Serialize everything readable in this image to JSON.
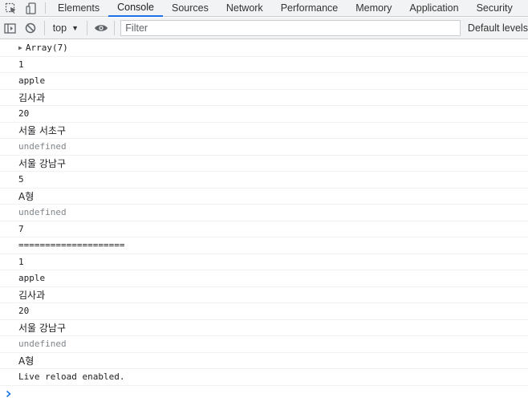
{
  "tabs": [
    "Elements",
    "Console",
    "Sources",
    "Network",
    "Performance",
    "Memory",
    "Application",
    "Security"
  ],
  "active_tab": "Console",
  "toolbar": {
    "context": "top",
    "filter_placeholder": "Filter",
    "levels_label": "Default levels"
  },
  "console": {
    "array_label": "Array(7)",
    "lines": [
      "1",
      "apple",
      "김사과",
      "20",
      "서울 서초구",
      "undefined",
      "서울 강남구",
      "5",
      "A형",
      "undefined",
      "7",
      "====================",
      "1",
      "apple",
      "김사과",
      "20",
      "서울 강남구",
      "undefined",
      "A형",
      "Live reload enabled."
    ]
  },
  "colors": {
    "accent": "#1a73e8",
    "toolbar_bg": "#f1f3f4",
    "undefined_text": "#80868b"
  },
  "icons": [
    "inspect-icon",
    "device-toggle-icon",
    "sidebar-toggle-icon",
    "clear-console-icon",
    "eye-icon",
    "prompt-chevron-icon"
  ]
}
